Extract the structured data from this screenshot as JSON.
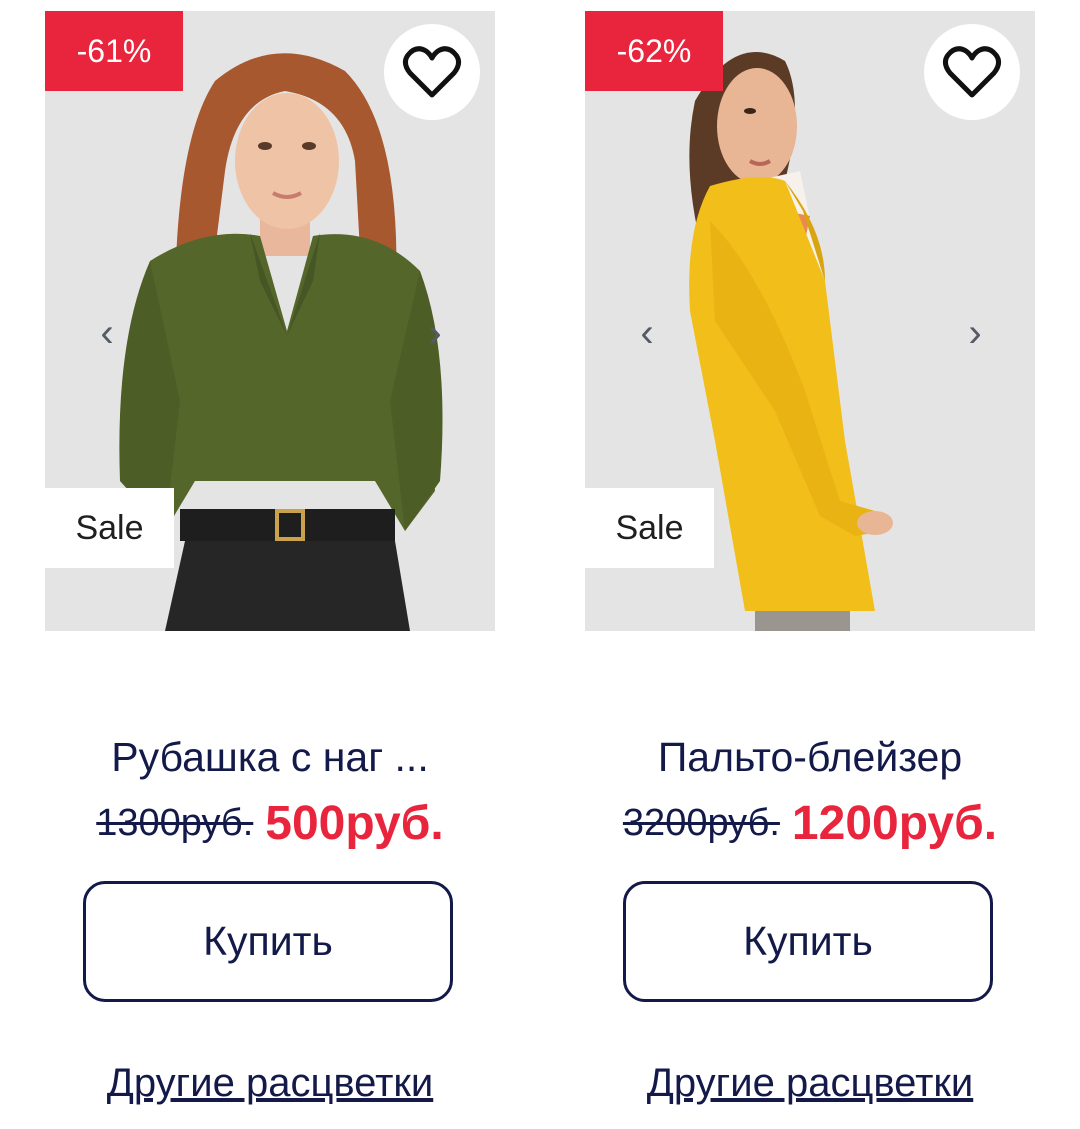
{
  "products": [
    {
      "discount": "-61%",
      "sale_label": "Sale",
      "arrow_left": "‹",
      "arrow_right": "›",
      "title": "Рубашка с наг ...",
      "old_price": "1300руб.",
      "new_price": "500руб.",
      "buy_label": "Купить",
      "colors_link": "Другие расцветки",
      "favorite_icon": "heart-outline-icon"
    },
    {
      "discount": "-62%",
      "sale_label": "Sale",
      "arrow_left": "‹",
      "arrow_right": "›",
      "title": "Пальто-блейзер",
      "old_price": "3200руб.",
      "new_price": "1200руб.",
      "buy_label": "Купить",
      "colors_link": "Другие расцветки",
      "favorite_icon": "heart-outline-icon"
    }
  ],
  "colors": {
    "accent_red": "#e8253c",
    "text_navy": "#131a4a",
    "photo_bg": "#e6e6e6"
  }
}
